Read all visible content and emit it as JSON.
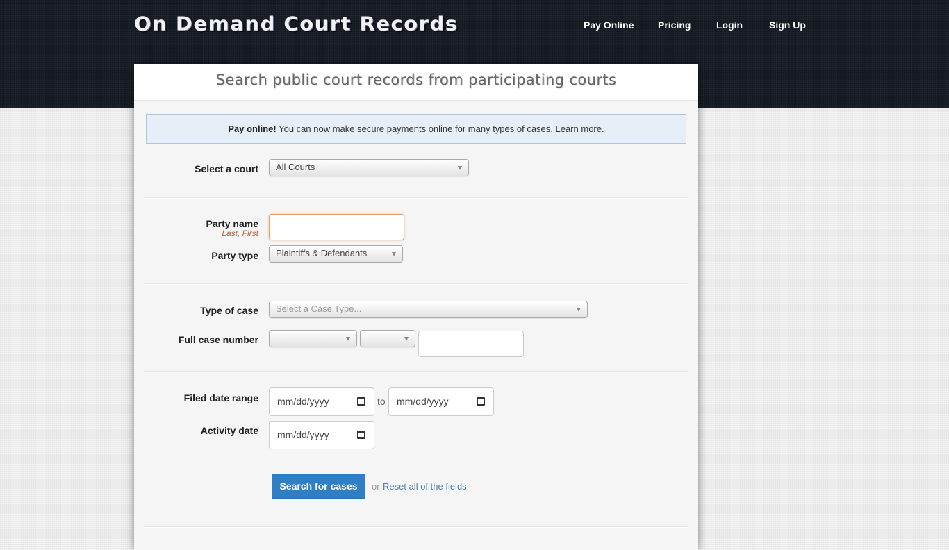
{
  "header": {
    "brand": "On Demand Court Records",
    "nav": [
      {
        "label": "Pay Online"
      },
      {
        "label": "Pricing"
      },
      {
        "label": "Login"
      },
      {
        "label": "Sign Up"
      }
    ]
  },
  "panel": {
    "title": "Search public court records from participating courts",
    "notice": {
      "bold": "Pay online!",
      "text": " You can now make secure payments online for many types of cases. ",
      "link": "Learn more."
    }
  },
  "form": {
    "court": {
      "label": "Select a court",
      "value": "All Courts"
    },
    "party_name": {
      "label": "Party name",
      "hint": "Last, First",
      "value": ""
    },
    "party_type": {
      "label": "Party type",
      "value": "Plaintiffs & Defendants"
    },
    "case_type": {
      "label": "Type of case",
      "placeholder": "Select a Case Type..."
    },
    "case_number": {
      "label": "Full case number",
      "part1": "",
      "part2": "",
      "part3": ""
    },
    "filed_date": {
      "label": "Filed date range",
      "from_placeholder": "mm/dd/yyyy",
      "to_label": "to",
      "to_placeholder": "mm/dd/yyyy"
    },
    "activity_date": {
      "label": "Activity date",
      "placeholder": "mm/dd/yyyy"
    },
    "submit_label": "Search for cases",
    "or_text": "or",
    "reset_label": "Reset all of the fields"
  }
}
